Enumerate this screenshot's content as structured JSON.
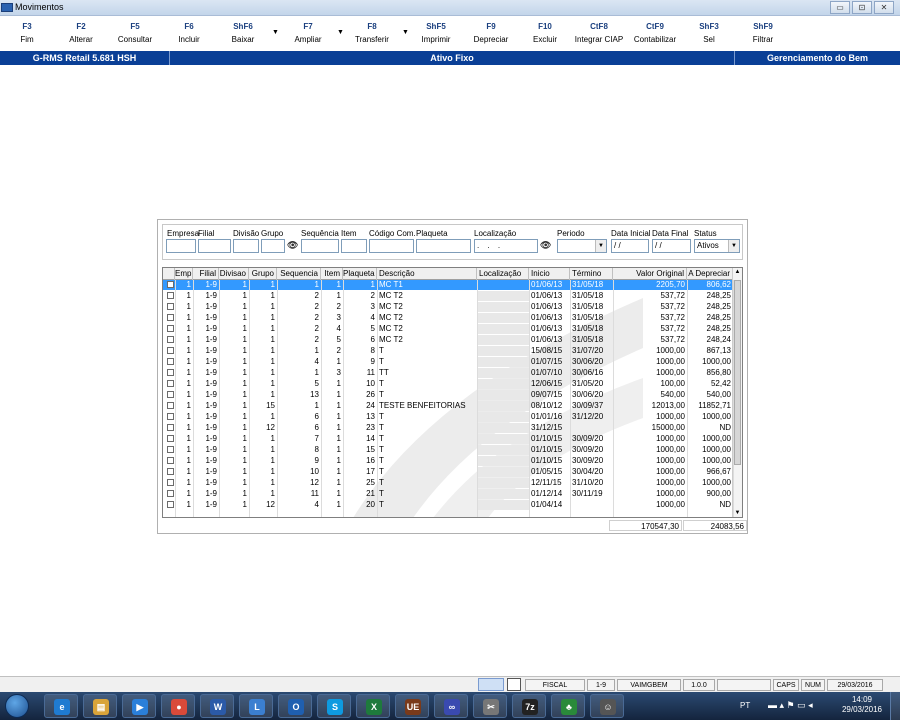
{
  "window": {
    "title": "Movimentos",
    "buttons": [
      "▭",
      "⊡",
      "✕"
    ]
  },
  "toolbar": [
    {
      "key": "F3",
      "label": "Fim"
    },
    {
      "key": "F2",
      "label": "Alterar"
    },
    {
      "key": "F5",
      "label": "Consultar"
    },
    {
      "key": "F6",
      "label": "Incluir"
    },
    {
      "key": "ShF6",
      "label": "Baixar"
    },
    {
      "key": "F7",
      "label": "Ampliar"
    },
    {
      "key": "F8",
      "label": "Transferir"
    },
    {
      "key": "ShF5",
      "label": "Imprimir"
    },
    {
      "key": "F9",
      "label": "Depreciar"
    },
    {
      "key": "F10",
      "label": "Excluir"
    },
    {
      "key": "CtF8",
      "label": "Integrar CIAP"
    },
    {
      "key": "CtF9",
      "label": "Contabilizar"
    },
    {
      "key": "ShF3",
      "label": "Sel"
    },
    {
      "key": "ShF9",
      "label": "Filtrar"
    }
  ],
  "bluebar": {
    "left": "G-RMS Retail 5.681 HSH",
    "center": "Ativo Fixo",
    "right": "Gerenciamento do Bem"
  },
  "filters": {
    "labels": [
      "Empresa",
      "Filial",
      "Divisão",
      "Grupo",
      "Sequência",
      "Item",
      "Código Com.",
      "Plaqueta",
      "Localização",
      "Periodo",
      "Data Inicial",
      "Data Final",
      "Status"
    ],
    "localizacao_value": ". . .",
    "data_inicial_value": "/ /",
    "data_final_value": "/ /",
    "status_value": "Ativos"
  },
  "grid": {
    "columns": [
      "Emp",
      "Filial",
      "Divisao",
      "Grupo",
      "Sequencia",
      "Item",
      "Plaqueta",
      "Descrição",
      "Localização",
      "Inicio",
      "Término",
      "Valor Original",
      "A Depreciar"
    ],
    "rows": [
      {
        "emp": "1",
        "filial": "1-9",
        "div": "1",
        "grupo": "1",
        "seq": "1",
        "item": "1",
        "plaq": "1",
        "desc": "MC T1",
        "loc": "",
        "ini": "01/06/13",
        "fim": "31/05/18",
        "valor": "2205,70",
        "adep": "806,62"
      },
      {
        "emp": "1",
        "filial": "1-9",
        "div": "1",
        "grupo": "1",
        "seq": "2",
        "item": "1",
        "plaq": "2",
        "desc": "MC T2",
        "loc": "",
        "ini": "01/06/13",
        "fim": "31/05/18",
        "valor": "537,72",
        "adep": "248,25"
      },
      {
        "emp": "1",
        "filial": "1-9",
        "div": "1",
        "grupo": "1",
        "seq": "2",
        "item": "2",
        "plaq": "3",
        "desc": "MC T2",
        "loc": "",
        "ini": "01/06/13",
        "fim": "31/05/18",
        "valor": "537,72",
        "adep": "248,25"
      },
      {
        "emp": "1",
        "filial": "1-9",
        "div": "1",
        "grupo": "1",
        "seq": "2",
        "item": "3",
        "plaq": "4",
        "desc": "MC T2",
        "loc": "",
        "ini": "01/06/13",
        "fim": "31/05/18",
        "valor": "537,72",
        "adep": "248,25"
      },
      {
        "emp": "1",
        "filial": "1-9",
        "div": "1",
        "grupo": "1",
        "seq": "2",
        "item": "4",
        "plaq": "5",
        "desc": "MC T2",
        "loc": "",
        "ini": "01/06/13",
        "fim": "31/05/18",
        "valor": "537,72",
        "adep": "248,25"
      },
      {
        "emp": "1",
        "filial": "1-9",
        "div": "1",
        "grupo": "1",
        "seq": "2",
        "item": "5",
        "plaq": "6",
        "desc": "MC T2",
        "loc": "",
        "ini": "01/06/13",
        "fim": "31/05/18",
        "valor": "537,72",
        "adep": "248,24"
      },
      {
        "emp": "1",
        "filial": "1-9",
        "div": "1",
        "grupo": "1",
        "seq": "1",
        "item": "2",
        "plaq": "8",
        "desc": "T",
        "loc": "",
        "ini": "15/08/15",
        "fim": "31/07/20",
        "valor": "1000,00",
        "adep": "867,13"
      },
      {
        "emp": "1",
        "filial": "1-9",
        "div": "1",
        "grupo": "1",
        "seq": "4",
        "item": "1",
        "plaq": "9",
        "desc": "T",
        "loc": "",
        "ini": "01/07/15",
        "fim": "30/06/20",
        "valor": "1000,00",
        "adep": "1000,00"
      },
      {
        "emp": "1",
        "filial": "1-9",
        "div": "1",
        "grupo": "1",
        "seq": "1",
        "item": "3",
        "plaq": "11",
        "desc": "TT",
        "loc": "",
        "ini": "01/07/10",
        "fim": "30/06/16",
        "valor": "1000,00",
        "adep": "856,80"
      },
      {
        "emp": "1",
        "filial": "1-9",
        "div": "1",
        "grupo": "1",
        "seq": "5",
        "item": "1",
        "plaq": "10",
        "desc": "T",
        "loc": "",
        "ini": "12/06/15",
        "fim": "31/05/20",
        "valor": "100,00",
        "adep": "52,42"
      },
      {
        "emp": "1",
        "filial": "1-9",
        "div": "1",
        "grupo": "1",
        "seq": "13",
        "item": "1",
        "plaq": "26",
        "desc": "T",
        "loc": "",
        "ini": "09/07/15",
        "fim": "30/06/20",
        "valor": "540,00",
        "adep": "540,00"
      },
      {
        "emp": "1",
        "filial": "1-9",
        "div": "1",
        "grupo": "15",
        "seq": "1",
        "item": "1",
        "plaq": "24",
        "desc": "TESTE BENFEITORIAS",
        "loc": "",
        "ini": "08/10/12",
        "fim": "30/09/37",
        "valor": "12013,00",
        "adep": "11852,71"
      },
      {
        "emp": "1",
        "filial": "1-9",
        "div": "1",
        "grupo": "1",
        "seq": "6",
        "item": "1",
        "plaq": "13",
        "desc": "T",
        "loc": "",
        "ini": "01/01/16",
        "fim": "31/12/20",
        "valor": "1000,00",
        "adep": "1000,00"
      },
      {
        "emp": "1",
        "filial": "1-9",
        "div": "1",
        "grupo": "12",
        "seq": "6",
        "item": "1",
        "plaq": "23",
        "desc": "T",
        "loc": "",
        "ini": "31/12/15",
        "fim": "",
        "valor": "15000,00",
        "adep": "ND"
      },
      {
        "emp": "1",
        "filial": "1-9",
        "div": "1",
        "grupo": "1",
        "seq": "7",
        "item": "1",
        "plaq": "14",
        "desc": "T",
        "loc": "",
        "ini": "01/10/15",
        "fim": "30/09/20",
        "valor": "1000,00",
        "adep": "1000,00"
      },
      {
        "emp": "1",
        "filial": "1-9",
        "div": "1",
        "grupo": "1",
        "seq": "8",
        "item": "1",
        "plaq": "15",
        "desc": "T",
        "loc": "",
        "ini": "01/10/15",
        "fim": "30/09/20",
        "valor": "1000,00",
        "adep": "1000,00"
      },
      {
        "emp": "1",
        "filial": "1-9",
        "div": "1",
        "grupo": "1",
        "seq": "9",
        "item": "1",
        "plaq": "16",
        "desc": "T",
        "loc": "",
        "ini": "01/10/15",
        "fim": "30/09/20",
        "valor": "1000,00",
        "adep": "1000,00"
      },
      {
        "emp": "1",
        "filial": "1-9",
        "div": "1",
        "grupo": "1",
        "seq": "10",
        "item": "1",
        "plaq": "17",
        "desc": "T",
        "loc": "",
        "ini": "01/05/15",
        "fim": "30/04/20",
        "valor": "1000,00",
        "adep": "966,67"
      },
      {
        "emp": "1",
        "filial": "1-9",
        "div": "1",
        "grupo": "1",
        "seq": "12",
        "item": "1",
        "plaq": "25",
        "desc": "T",
        "loc": "",
        "ini": "12/11/15",
        "fim": "31/10/20",
        "valor": "1000,00",
        "adep": "1000,00"
      },
      {
        "emp": "1",
        "filial": "1-9",
        "div": "1",
        "grupo": "1",
        "seq": "11",
        "item": "1",
        "plaq": "21",
        "desc": "T",
        "loc": "",
        "ini": "01/12/14",
        "fim": "30/11/19",
        "valor": "1000,00",
        "adep": "900,00"
      },
      {
        "emp": "1",
        "filial": "1-9",
        "div": "1",
        "grupo": "12",
        "seq": "4",
        "item": "1",
        "plaq": "20",
        "desc": "T",
        "loc": "",
        "ini": "01/04/14",
        "fim": "",
        "valor": "1000,00",
        "adep": "ND"
      }
    ],
    "total_valor": "170547,30",
    "total_adep": "24083,56"
  },
  "statusbar": {
    "fields": [
      "FISCAL",
      "1-9",
      "VAIMGBEM",
      "1.0.0",
      "",
      "CAPS",
      "NUM",
      "29/03/2016"
    ]
  },
  "taskbar": {
    "apps": [
      {
        "name": "ie",
        "glyph": "e",
        "color": "#1f7bd1"
      },
      {
        "name": "explorer",
        "glyph": "▤",
        "color": "#d9a43a"
      },
      {
        "name": "media",
        "glyph": "▶",
        "color": "#2a7fd9"
      },
      {
        "name": "chrome",
        "glyph": "●",
        "color": "#d94a3a"
      },
      {
        "name": "word",
        "glyph": "W",
        "color": "#2b5aa8"
      },
      {
        "name": "app-lb",
        "glyph": "L",
        "color": "#3b7fd0"
      },
      {
        "name": "outlook",
        "glyph": "O",
        "color": "#1f5fb0"
      },
      {
        "name": "skype",
        "glyph": "S",
        "color": "#0e9ae0"
      },
      {
        "name": "excel",
        "glyph": "X",
        "color": "#1e7a3c"
      },
      {
        "name": "app-ue",
        "glyph": "UE",
        "color": "#7a3a1a"
      },
      {
        "name": "app-infinity",
        "glyph": "∞",
        "color": "#3a4ab0"
      },
      {
        "name": "app-tools",
        "glyph": "✂",
        "color": "#777777"
      },
      {
        "name": "7zip",
        "glyph": "7z",
        "color": "#222222"
      },
      {
        "name": "app-green",
        "glyph": "♣",
        "color": "#2a8a3a"
      },
      {
        "name": "app-person",
        "glyph": "☺",
        "color": "#555555"
      }
    ],
    "lang": "PT",
    "time": "14:09",
    "date": "29/03/2016"
  }
}
